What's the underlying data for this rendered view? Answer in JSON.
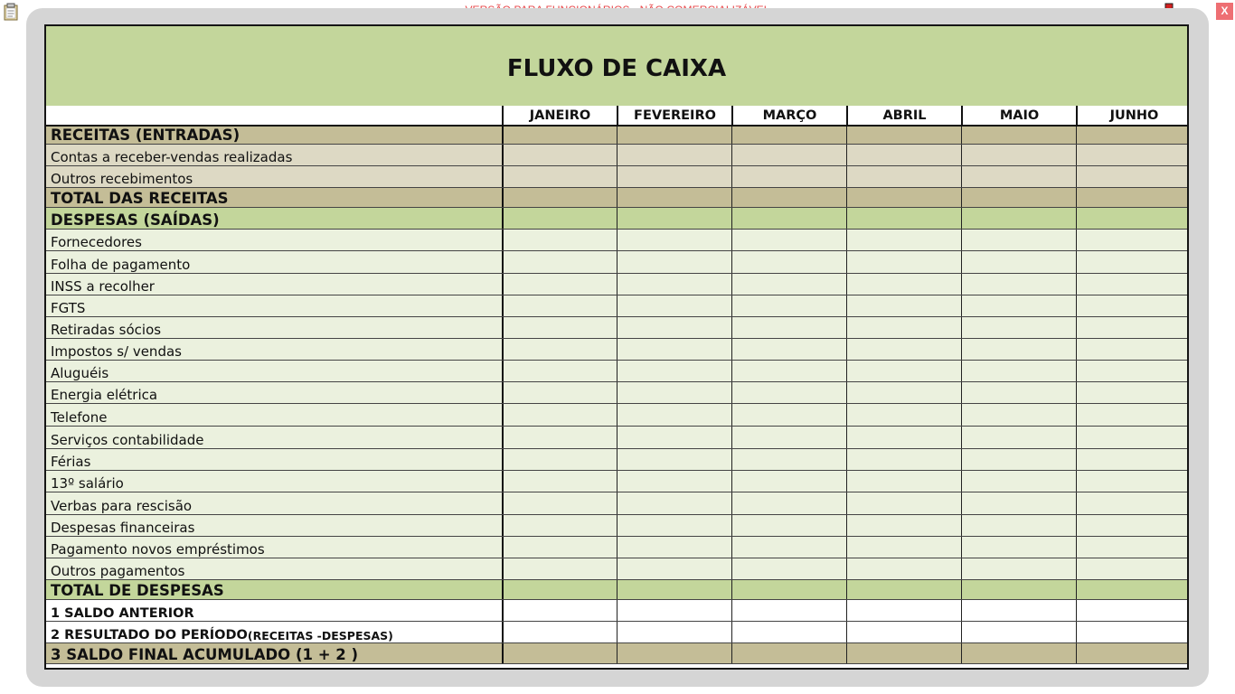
{
  "window": {
    "title": "VERSÃO PARA FUNCIONÁRIOS - NÃO COMERCIALIZÁVEL",
    "close_label": "X"
  },
  "sheet": {
    "title": "FLUXO DE CAIXA",
    "months": [
      "JANEIRO",
      "FEVEREIRO",
      "MARÇO",
      "ABRIL",
      "MAIO",
      "JUNHO"
    ],
    "rows": [
      {
        "label": "RECEITAS (ENTRADAS)",
        "style": "section",
        "color": "#c4bd97"
      },
      {
        "label": "Contas a receber-vendas realizadas",
        "style": "item",
        "color": "#ddd9c4"
      },
      {
        "label": "Outros recebimentos",
        "style": "item",
        "color": "#ddd9c4"
      },
      {
        "label": "TOTAL DAS RECEITAS",
        "style": "section",
        "color": "#c4bd97"
      },
      {
        "label": "DESPESAS (SAÍDAS)",
        "style": "section",
        "color": "#c3d69b"
      },
      {
        "label": "Fornecedores",
        "style": "item",
        "color": "#ebf1de"
      },
      {
        "label": "Folha de pagamento",
        "style": "item",
        "color": "#ebf1de"
      },
      {
        "label": "INSS a recolher",
        "style": "item",
        "color": "#ebf1de"
      },
      {
        "label": "FGTS",
        "style": "item",
        "color": "#ebf1de"
      },
      {
        "label": "Retiradas sócios",
        "style": "item",
        "color": "#ebf1de"
      },
      {
        "label": "Impostos s/ vendas",
        "style": "item",
        "color": "#ebf1de"
      },
      {
        "label": "Aluguéis",
        "style": "item",
        "color": "#ebf1de"
      },
      {
        "label": "Energia elétrica",
        "style": "item",
        "color": "#ebf1de"
      },
      {
        "label": "Telefone",
        "style": "item",
        "color": "#ebf1de"
      },
      {
        "label": "Serviços contabilidade",
        "style": "item",
        "color": "#ebf1de"
      },
      {
        "label": "Férias",
        "style": "item",
        "color": "#ebf1de"
      },
      {
        "label": "13º salário",
        "style": "item",
        "color": "#ebf1de"
      },
      {
        "label": "Verbas para rescisão",
        "style": "item",
        "color": "#ebf1de"
      },
      {
        "label": "Despesas financeiras",
        "style": "item",
        "color": "#ebf1de"
      },
      {
        "label": "Pagamento novos empréstimos",
        "style": "item",
        "color": "#ebf1de"
      },
      {
        "label": "Outros pagamentos",
        "style": "item",
        "color": "#ebf1de"
      },
      {
        "label": "TOTAL DE DESPESAS",
        "style": "section",
        "color": "#c3d69b"
      },
      {
        "label": "1 SALDO ANTERIOR",
        "style": "bold-sm",
        "color": "#ffffff"
      },
      {
        "label": "2 RESULTADO DO PERÍODO",
        "suffix": " (RECEITAS -DESPESAS)",
        "style": "bold-sm",
        "color": "#ffffff"
      },
      {
        "label": "3 SALDO FINAL ACUMULADO (1 + 2 )",
        "style": "section",
        "color": "#c4bd97"
      }
    ]
  }
}
